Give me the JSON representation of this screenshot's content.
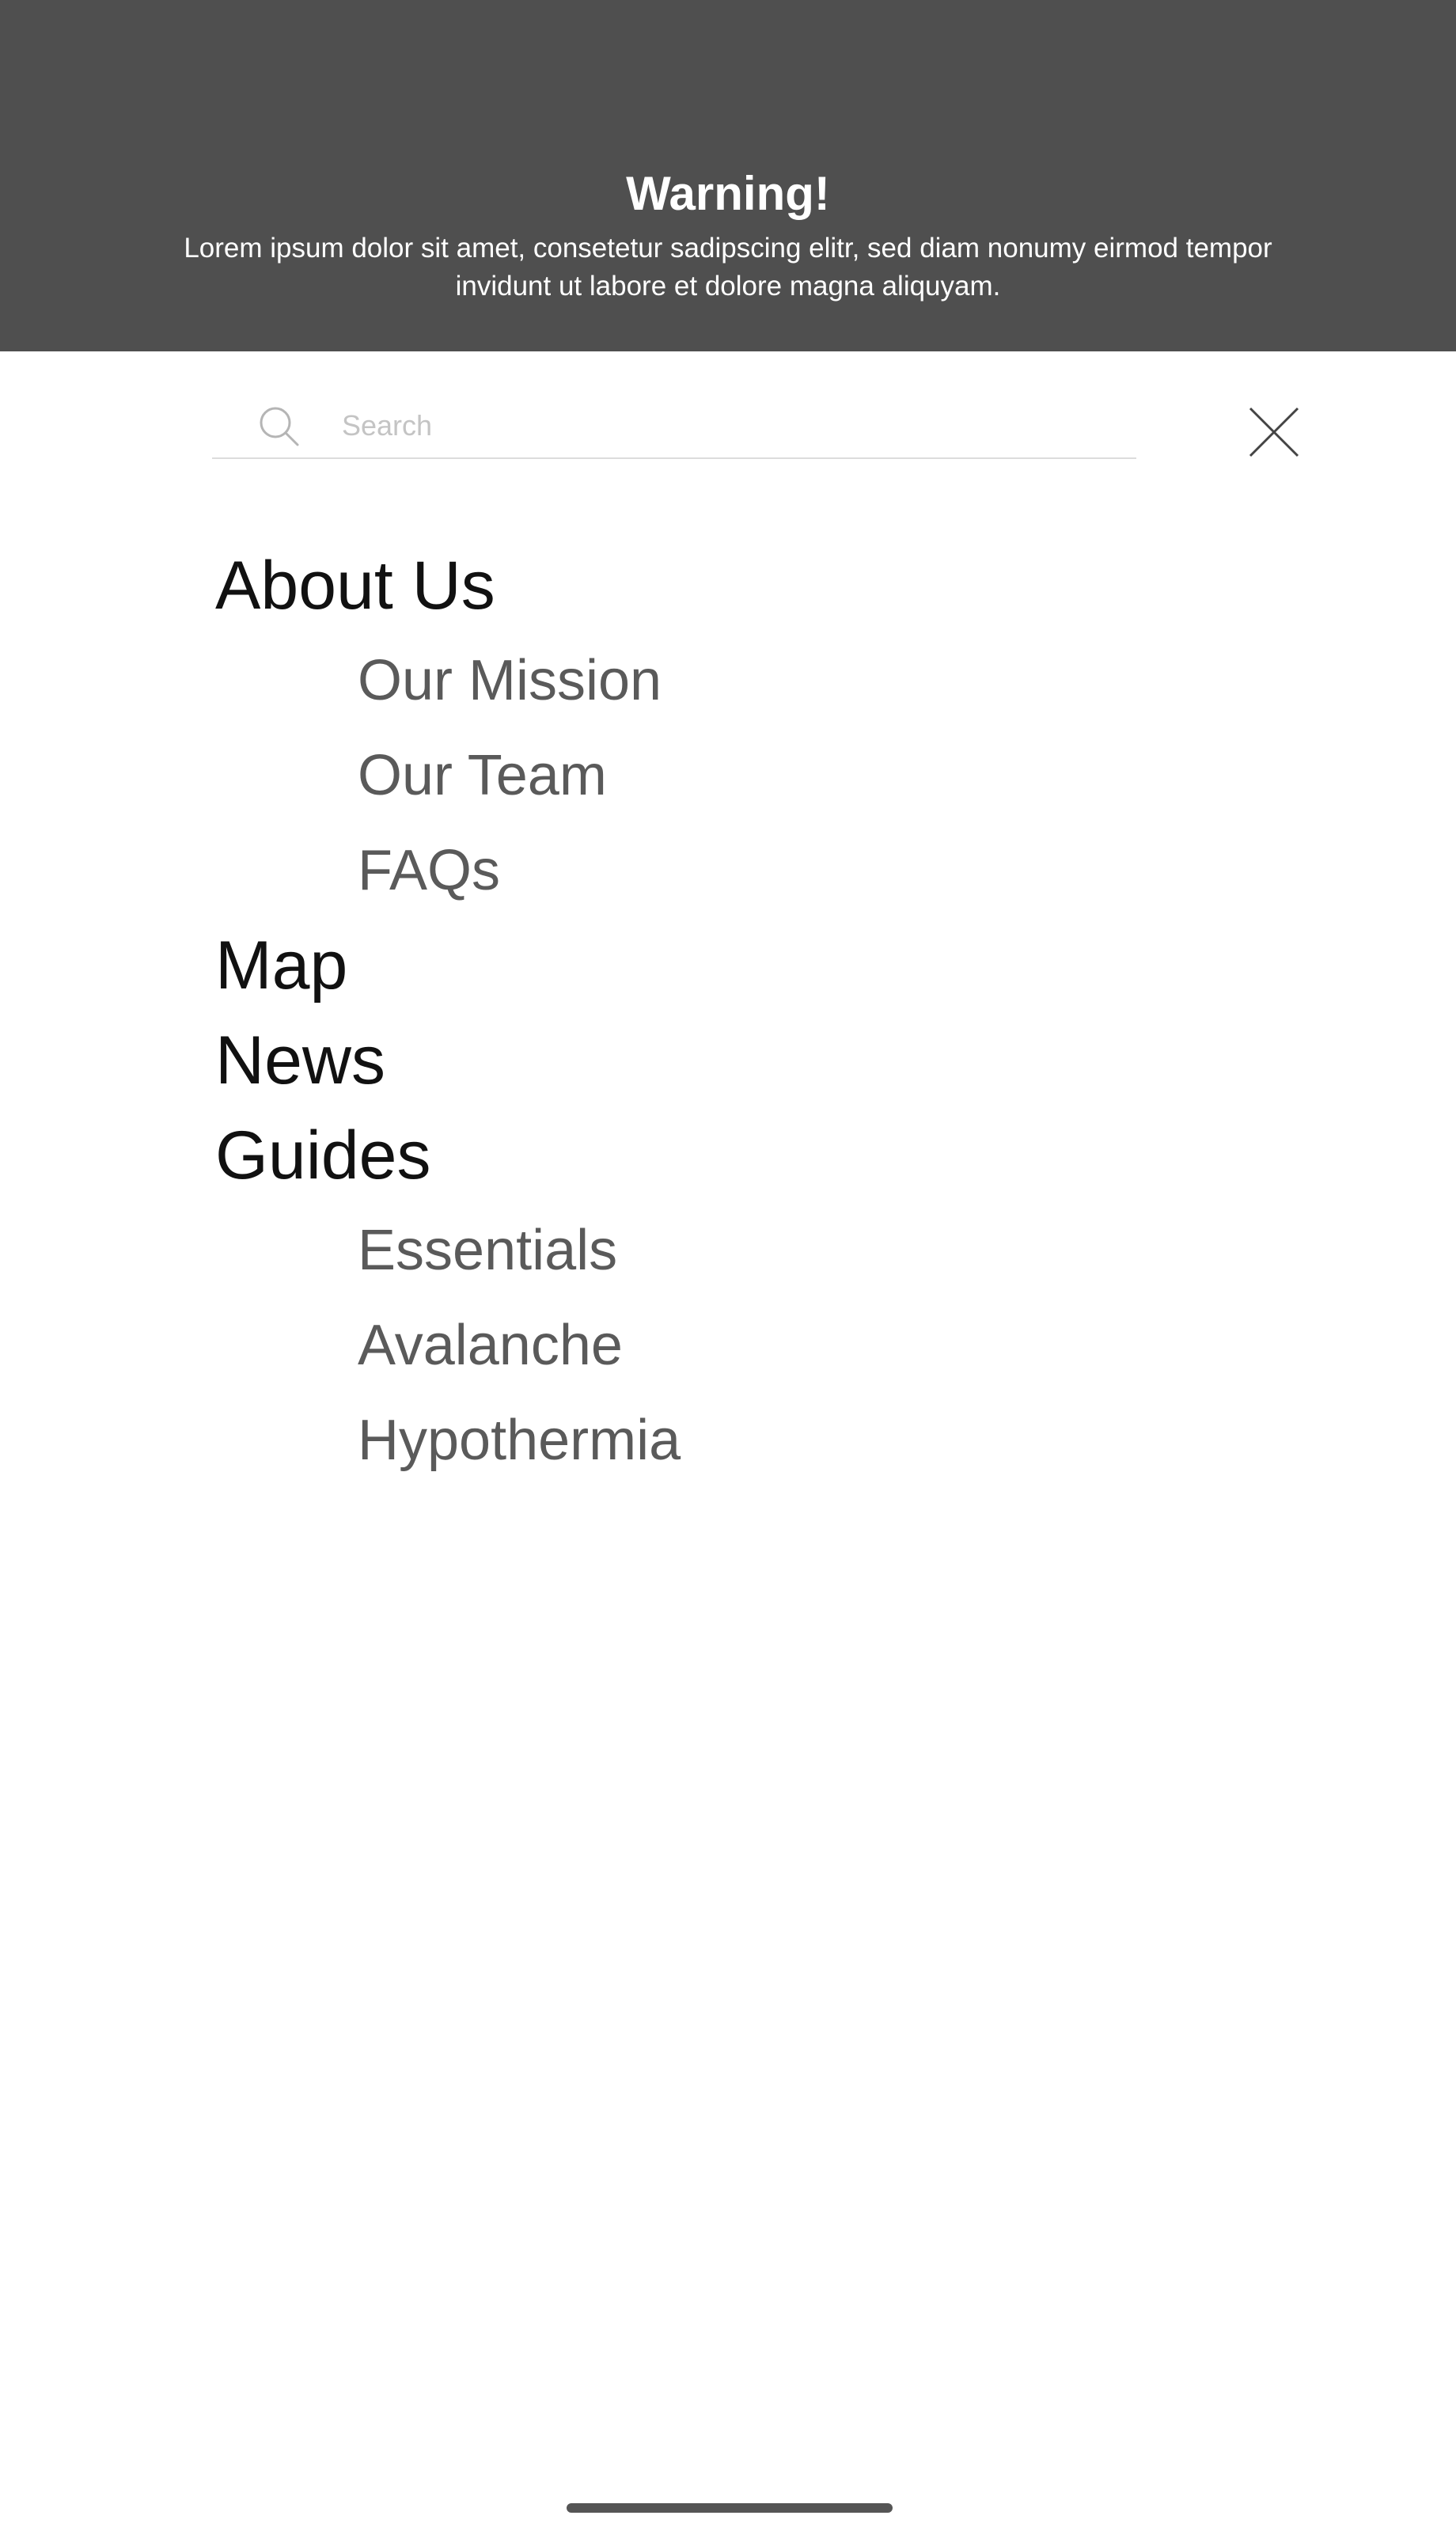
{
  "warning": {
    "title": "Warning!",
    "body": "Lorem ipsum dolor sit amet, consetetur sadipscing elitr, sed diam nonumy eirmod tempor invidunt ut labore et dolore magna aliquyam."
  },
  "search": {
    "placeholder": "Search",
    "value": "",
    "icon": "search-icon"
  },
  "close": {
    "icon": "close-icon"
  },
  "nav": {
    "about": {
      "label": "About Us",
      "children": [
        "Our Mission",
        "Our Team",
        "FAQs"
      ]
    },
    "map": {
      "label": "Map"
    },
    "news": {
      "label": "News"
    },
    "guides": {
      "label": "Guides",
      "children": [
        "Essentials",
        "Avalanche",
        "Hypothermia"
      ]
    }
  },
  "colors": {
    "banner_bg": "#4f4f4f",
    "banner_text": "#ffffff",
    "primary_text": "#111111",
    "secondary_text": "#5a5a5a"
  }
}
